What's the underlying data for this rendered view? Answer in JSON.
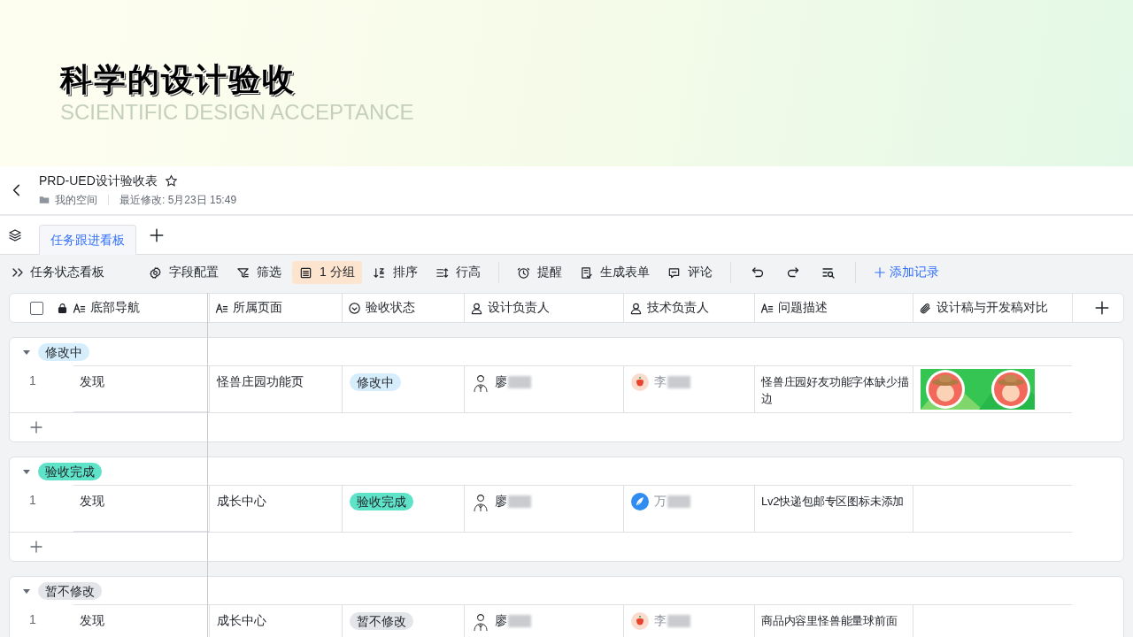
{
  "banner": {
    "title": "科学的设计验收",
    "subtitle": "SCIENTIFIC DESIGN ACCEPTANCE"
  },
  "document": {
    "title": "PRD-UED设计验收表",
    "starred": false,
    "location": "我的空间",
    "modified": "最近修改: 5月23日 15:49"
  },
  "tabs": [
    {
      "label": "任务跟进看板",
      "selected": true
    }
  ],
  "toolbar": {
    "view_switch": "任务状态看板",
    "view_tools": [
      {
        "label": "字段配置",
        "active": false
      },
      {
        "label": "筛选",
        "active": false
      },
      {
        "label": "1 分组",
        "active": true
      },
      {
        "label": "排序",
        "active": false
      },
      {
        "label": "行高",
        "active": false
      }
    ],
    "share_tools": [
      {
        "label": "提醒",
        "active": false
      },
      {
        "label": "生成表单",
        "active": false
      },
      {
        "label": "评论",
        "active": false
      }
    ],
    "add_record": "添加记录"
  },
  "select_all": {
    "checked": false
  },
  "columns": [
    {
      "label": "底部导航",
      "kind": "text"
    },
    {
      "label": "所属页面",
      "kind": "text"
    },
    {
      "label": "验收状态",
      "kind": "status"
    },
    {
      "label": "设计负责人",
      "kind": "person"
    },
    {
      "label": "技术负责人",
      "kind": "person"
    },
    {
      "label": "问题描述",
      "kind": "text"
    },
    {
      "label": "设计稿与开发稿对比",
      "kind": "attachment"
    }
  ],
  "groups": [
    {
      "label": "修改中",
      "color": "#d6eefc",
      "expanded": true,
      "rows": [
        {
          "number": "1",
          "nav": "发现",
          "page": "怪兽庄园功能页",
          "status": {
            "label": "修改中",
            "color": "#d6eefc"
          },
          "designer": {
            "name": "廖"
          },
          "developer": {
            "name": "李",
            "kind": "pepper"
          },
          "description": "怪兽庄园好友功能字体缺少描边"
        }
      ]
    },
    {
      "label": "验收完成",
      "color": "#5fe3c8",
      "expanded": true,
      "rows": [
        {
          "number": "1",
          "nav": "发现",
          "page": "成长中心",
          "status": {
            "label": "验收完成",
            "color": "#5fe3c8"
          },
          "designer": {
            "name": "廖"
          },
          "developer": {
            "name": "万",
            "kind": "feather"
          },
          "description": "Lv2快递包邮专区图标未添加"
        }
      ]
    },
    {
      "label": "暂不修改",
      "color": "#e3e5e9",
      "expanded": true,
      "rows": [
        {
          "number": "1",
          "nav": "发现",
          "page": "成长中心",
          "status": {
            "label": "暂不修改",
            "color": "#e3e5e9"
          },
          "designer": {
            "name": "廖"
          },
          "developer": {
            "name": "李",
            "kind": "pepper"
          },
          "description": "商品内容里怪兽能量球前面"
        }
      ]
    }
  ]
}
